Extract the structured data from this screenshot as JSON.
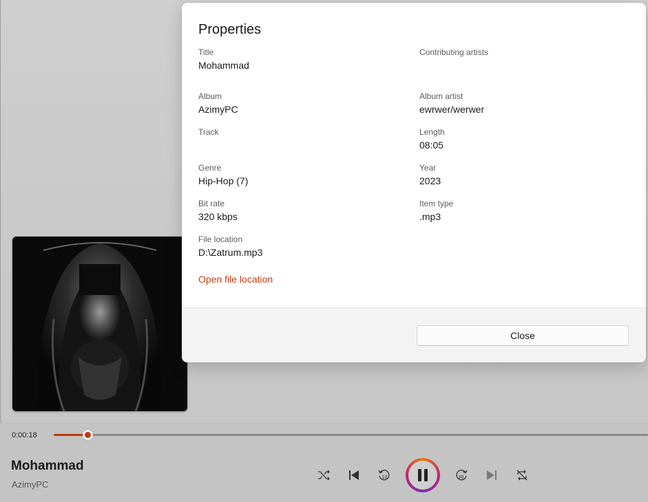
{
  "dialog": {
    "title": "Properties",
    "properties": {
      "title": {
        "label": "Title",
        "value": "Mohammad"
      },
      "contributing_artists": {
        "label": "Contributing artists",
        "value": ""
      },
      "album": {
        "label": "Album",
        "value": "AzimyPC"
      },
      "album_artist": {
        "label": "Album artist",
        "value": "ewrwer/werwer"
      },
      "track": {
        "label": "Track",
        "value": ""
      },
      "length": {
        "label": "Length",
        "value": "08:05"
      },
      "genre": {
        "label": "Genre",
        "value": "Hip-Hop (7)"
      },
      "year": {
        "label": "Year",
        "value": "2023"
      },
      "bit_rate": {
        "label": "Bit rate",
        "value": "320 kbps"
      },
      "item_type": {
        "label": "Item type",
        "value": ".mp3"
      },
      "file_location": {
        "label": "File location",
        "value": "D:\\Zatrum.mp3"
      }
    },
    "open_file_location_label": "Open file location",
    "close_label": "Close"
  },
  "player": {
    "elapsed": "0:00:18",
    "progress_fraction": 0.0373,
    "track_title": "Mohammad",
    "track_artist": "AzimyPC",
    "controls": [
      "shuffle-icon",
      "previous-icon",
      "rewind-10-icon",
      "pause-icon",
      "forward-30-icon",
      "next-icon",
      "repeat-off-icon"
    ]
  },
  "colors": {
    "accent": "#c43e10",
    "play_ring": [
      "#e07b1c",
      "#c2256a",
      "#7b2fb3"
    ]
  }
}
